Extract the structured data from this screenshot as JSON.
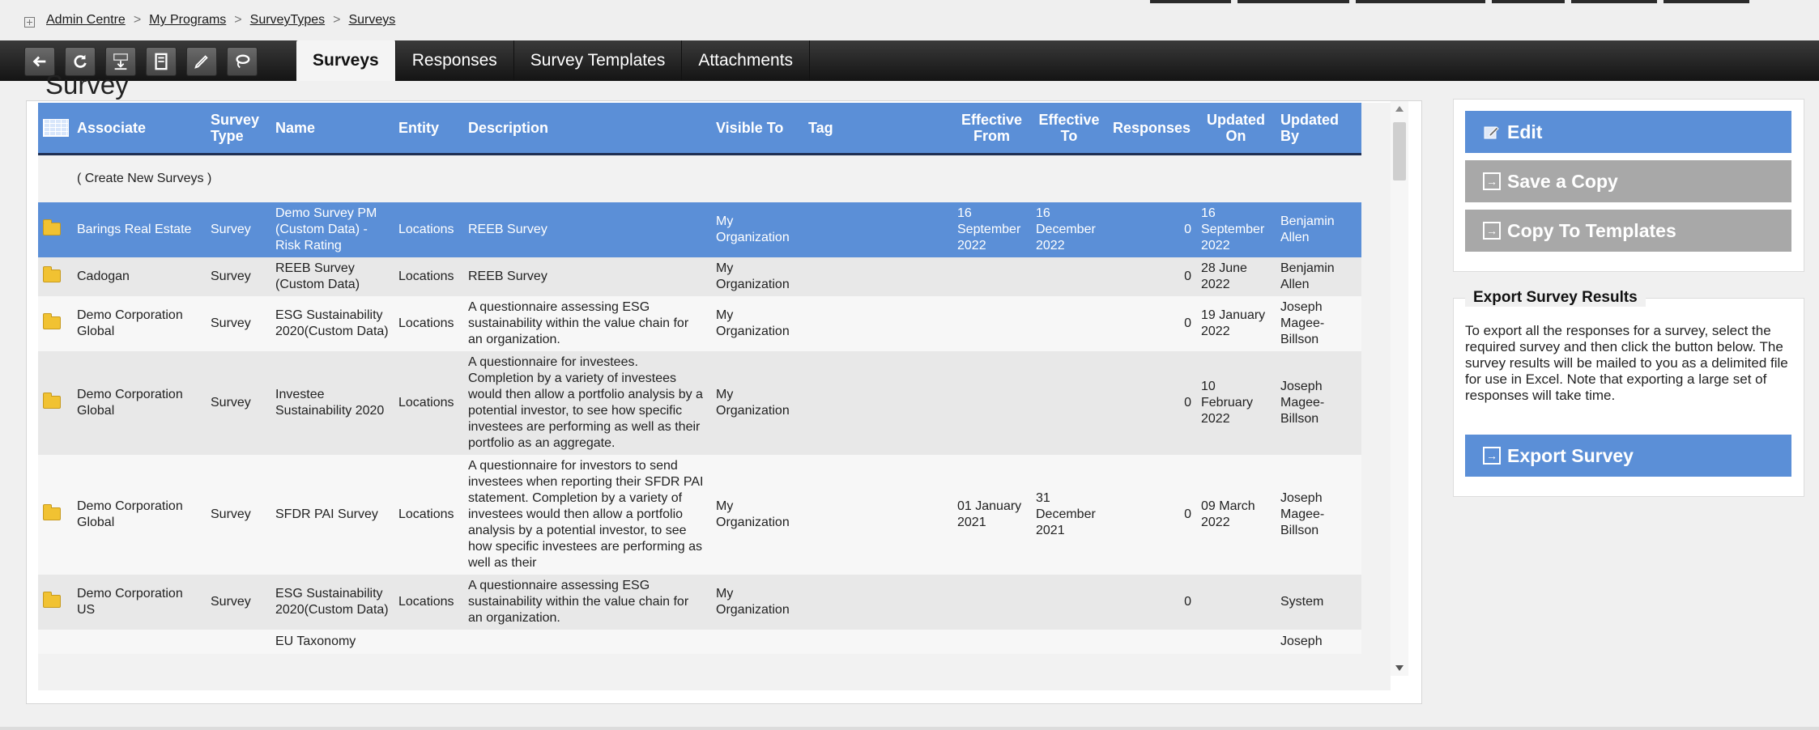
{
  "breadcrumb": [
    "Admin Centre",
    "My Programs",
    "SurveyTypes",
    "Surveys"
  ],
  "breadcrumb_sep": ">",
  "toolbar": {
    "tools": [
      "back-arrow-icon",
      "refresh-icon",
      "pdf-download-icon",
      "document-icon",
      "pencil-icon",
      "lasso-icon"
    ],
    "tabs": [
      {
        "label": "Surveys",
        "active": true
      },
      {
        "label": "Responses",
        "active": false
      },
      {
        "label": "Survey Templates",
        "active": false
      },
      {
        "label": "Attachments",
        "active": false
      }
    ]
  },
  "page_title": "Survey",
  "table": {
    "columns": [
      "Associate",
      "Survey Type",
      "Name",
      "Entity",
      "Description",
      "Visible To",
      "Tag",
      "Effective From",
      "Effective To",
      "Responses",
      "Updated On",
      "Updated By"
    ],
    "create_label": "( Create New Surveys )",
    "rows": [
      {
        "associate": "Barings Real Estate",
        "type": "Survey",
        "name": "Demo Survey PM (Custom Data) - Risk Rating",
        "entity": "Locations",
        "description": "REEB Survey",
        "visible": "My Organization",
        "tag": "",
        "from": "16 September 2022",
        "to": "16 December 2022",
        "responses": "0",
        "updated_on": "16 September 2022",
        "updated_by": "Benjamin Allen",
        "selected": true
      },
      {
        "associate": "Cadogan",
        "type": "Survey",
        "name": "REEB Survey (Custom Data)",
        "entity": "Locations",
        "description": "REEB Survey",
        "visible": "My Organization",
        "tag": "",
        "from": "",
        "to": "",
        "responses": "0",
        "updated_on": "28 June 2022",
        "updated_by": "Benjamin Allen",
        "selected": false
      },
      {
        "associate": "Demo Corporation Global",
        "type": "Survey",
        "name": "ESG Sustainability 2020(Custom Data)",
        "entity": "Locations",
        "description": "A questionnaire assessing ESG sustainability within the value chain for an organization.",
        "visible": "My Organization",
        "tag": "",
        "from": "",
        "to": "",
        "responses": "0",
        "updated_on": "19 January 2022",
        "updated_by": "Joseph Magee-Billson",
        "selected": false
      },
      {
        "associate": "Demo Corporation Global",
        "type": "Survey",
        "name": "Investee Sustainability 2020",
        "entity": "Locations",
        "description": "A questionnaire for investees. Completion by a variety of investees would then allow a portfolio analysis by a potential investor, to see how specific investees are performing as well as their portfolio as an aggregate.",
        "visible": "My Organization",
        "tag": "",
        "from": "",
        "to": "",
        "responses": "0",
        "updated_on": "10 February 2022",
        "updated_by": "Joseph Magee-Billson",
        "selected": false
      },
      {
        "associate": "Demo Corporation Global",
        "type": "Survey",
        "name": "SFDR PAI Survey",
        "entity": "Locations",
        "description": "A questionnaire for investors to send investees when reporting their SFDR PAI statement. Completion by a variety of investees would then allow a portfolio analysis by a potential investor, to see how specific investees are performing as well as their",
        "visible": "My Organization",
        "tag": "",
        "from": "01 January 2021",
        "to": "31 December 2021",
        "responses": "0",
        "updated_on": "09 March 2022",
        "updated_by": "Joseph Magee-Billson",
        "selected": false
      },
      {
        "associate": "Demo Corporation US",
        "type": "Survey",
        "name": "ESG Sustainability 2020(Custom Data)",
        "entity": "Locations",
        "description": "A questionnaire assessing ESG sustainability within the value chain for an organization.",
        "visible": "My Organization",
        "tag": "",
        "from": "",
        "to": "",
        "responses": "0",
        "updated_on": "",
        "updated_by": "System",
        "selected": false
      },
      {
        "associate": "",
        "type": "",
        "name": "EU Taxonomy",
        "entity": "",
        "description": "",
        "visible": "",
        "tag": "",
        "from": "",
        "to": "",
        "responses": "",
        "updated_on": "",
        "updated_by": "Joseph",
        "selected": false
      }
    ]
  },
  "actions": {
    "edit": "Edit",
    "save_copy": "Save a Copy",
    "copy_templates": "Copy To Templates"
  },
  "export": {
    "title": "Export Survey Results",
    "text": "To export all the responses for a survey, select the required survey and then click the button below. The survey results will be mailed to you as a delimited file for use in Excel. Note that exporting a large set of responses will take time.",
    "button": "Export Survey"
  },
  "colors": {
    "accent": "#5b8fd7",
    "disabled": "#a8a8a8",
    "toolbar": "#1e1e1e"
  }
}
